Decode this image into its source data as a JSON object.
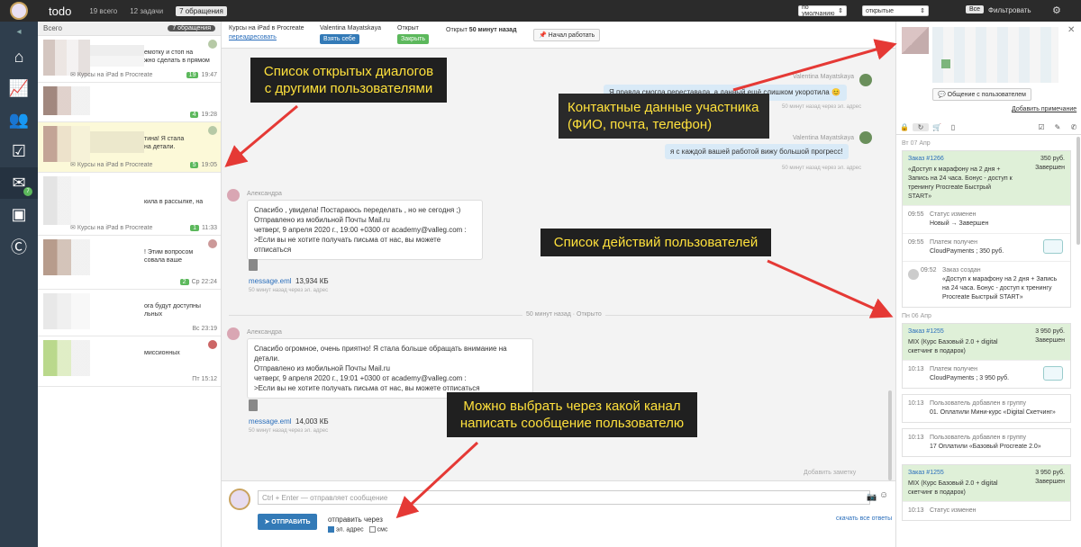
{
  "topbar": {
    "app_title": "todo",
    "stats": [
      "19 всего",
      "12 задачи",
      "7 обращения"
    ],
    "sort_select": "по умолчанию",
    "state_select": "открытые",
    "all_chip": "Все",
    "filter_label": "Фильтровать"
  },
  "nav": {
    "mail_badge": "7"
  },
  "conversations": {
    "header_label": "Всего",
    "header_badge": "7 обращения",
    "items": [
      {
        "snippet": "емотку и стоп на\nжно сделать в прямом",
        "course": "Курсы на iPad в Procreate",
        "count": "19",
        "time": "19:47"
      },
      {
        "snippet": "",
        "course": "",
        "count": "4",
        "time": "19:28"
      },
      {
        "snippet": "тина! Я стала\nна детали.",
        "course": "Курсы на iPad в Procreate",
        "count": "5",
        "time": "19:05"
      },
      {
        "snippet": "кила в рассылке, на",
        "course": "Курсы на iPad в Procreate",
        "count": "1",
        "time": "11:33"
      },
      {
        "snippet": "! Этим вопросом\nсовала ваше",
        "course": "",
        "count": "2",
        "time": "Ср 22:24"
      },
      {
        "snippet": "ога будут доступны\nльных",
        "course": "",
        "count": "",
        "time": "Вс 23:19"
      },
      {
        "snippet": "миссионных",
        "course": "",
        "count": "",
        "time": "Пт 15:12"
      }
    ]
  },
  "chat_header": {
    "course": "Курсы на iPad в Procreate",
    "reassign": "переадресовать",
    "user_name": "Valentina Mayatskaya",
    "take_btn": "Взять себе",
    "status": "Открыт",
    "close_btn": "Закрыть",
    "open_since_prefix": "Открыт",
    "open_since_value": "50 минут назад",
    "start_btn": "Начал работать"
  },
  "messages": {
    "m1_author": "Valentina Mayatskaya",
    "m1_text": "Я правда смогла переставала, а данный ещё слишком укоротила 😊",
    "m1_time": "50 минут назад через эл. адрес",
    "m2_author": "Valentina Mayatskaya",
    "m2_text": "я с каждой вашей работой вижу большой прогресс!",
    "m2_time": "50 минут назад через эл. адрес",
    "m3_author": "Александра",
    "m3_lines": [
      "Спасибо , увидела! Постараюсь переделать , но не сегодня ;)",
      "Отправлено из мобильной Почты Mail.ru",
      "четверг, 9 апреля 2020 г., 19:00 +0300 от academy@valleg.com :",
      ">Если вы не хотите получать письма от нас, вы можете отписаться"
    ],
    "m3_file": "message.eml",
    "m3_size": "13,934 КБ",
    "m3_time": "50 минут назад через эл. адрес",
    "divider": "50 минут назад · Открыто",
    "m4_author": "Александра",
    "m4_lines": [
      "Спасибо огромное, очень приятно! Я стала больше обращать внимание на детали.",
      "Отправлено из мобильной Почты Mail.ru",
      "четверг, 9 апреля 2020 г., 19:01 +0300 от academy@valleg.com :",
      ">Если вы не хотите получать письма от нас, вы можете отписаться"
    ],
    "m4_file": "message.eml",
    "m4_size": "14,003 КБ",
    "m4_time": "50 минут назад через эл. адрес",
    "add_note": "Добавить заметку"
  },
  "composer": {
    "placeholder": "Ctrl + Enter — отправляет сообщение",
    "send_btn": "ОТПРАВИТЬ",
    "send_via": "отправить через",
    "channel_email": "эл. адрес",
    "channel_sms": "смс",
    "download_replies": "скачать все ответы"
  },
  "right_panel": {
    "contact_btn": "Общение с пользователем",
    "add_note": "Добавить примечание",
    "feed": [
      {
        "date": "Вт 07 Апр",
        "order_id": "Заказ #1266",
        "price": "350 руб.",
        "status": "Завершен",
        "desc": "«Доступ к марафону на 2 дня + Запись на 24 часа. Бонус - доступ к тренингу Procreate Быстрый START»",
        "events": [
          {
            "time": "09:55",
            "label": "Статус изменен",
            "text": "Новый → Завершен",
            "icon": ""
          },
          {
            "time": "09:55",
            "label": "Платеж получен",
            "text": "CloudPayments ; 350 руб.",
            "icon": "cloud"
          },
          {
            "time": "09:52",
            "label": "Заказ создан",
            "text": "«Доступ к марафону на 2 дня + Запись на 24 часа. Бонус - доступ к тренингу Procreate Быстрый START»",
            "icon": "user"
          }
        ]
      },
      {
        "date": "Пн 06 Апр",
        "order_id": "Заказ #1255",
        "price": "3 950 руб.",
        "status": "Завершен",
        "desc": "MIX (Курс Базовый 2.0 + digital скетчинг в подарок)",
        "events": [
          {
            "time": "10:13",
            "label": "Платеж получен",
            "text": "CloudPayments ; 3 950 руб.",
            "icon": "cloud"
          }
        ]
      }
    ],
    "standalone": [
      {
        "time": "10:13",
        "label": "Пользователь добавлен в группу",
        "text": "01. Оплатили Мини-курс «Digital Скетчинг»"
      },
      {
        "time": "10:13",
        "label": "Пользователь добавлен в группу",
        "text": "17 Оплатили «Базовый Procreate 2.0»"
      }
    ],
    "order3": {
      "order_id": "Заказ #1255",
      "price": "3 950 руб.",
      "status": "Завершен",
      "desc": "MIX (Курс Базовый 2.0 + digital скетчинг в подарок)",
      "event_time": "10:13",
      "event_label": "Статус изменен"
    }
  },
  "annotations": {
    "dialogs": "Список открытых диалогов\nс другими пользователями",
    "contact": "Контактные данные участника\n(ФИО, почта, телефон)",
    "actions": "Список действий пользователей",
    "channel": "Можно выбрать через какой канал\nнаписать сообщение пользователю"
  },
  "colors": {
    "accent": "#337ab7",
    "success": "#5cb85c",
    "annotation_bg": "#202020",
    "annotation_text": "#ffe13c",
    "arrow": "#e53935"
  }
}
